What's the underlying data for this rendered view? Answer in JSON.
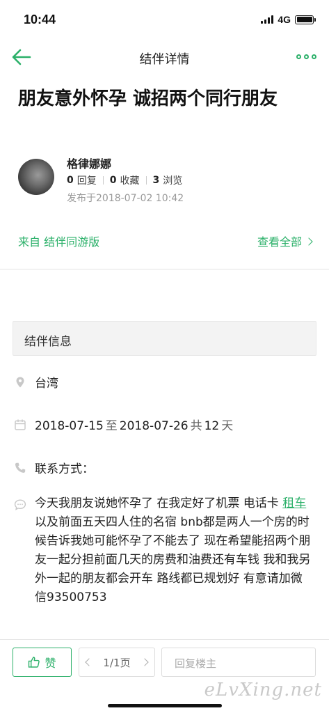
{
  "status": {
    "time": "10:44",
    "network": "4G"
  },
  "nav": {
    "title": "结伴详情"
  },
  "post": {
    "title": "朋友意外怀孕 诚招两个同行朋友",
    "author": "格律娜娜",
    "replies_count": "0",
    "replies_label": "回复",
    "favorites_count": "0",
    "favorites_label": "收藏",
    "views_count": "3",
    "views_label": "浏览",
    "published": "发布于2018-07-02 10:42"
  },
  "source": {
    "label": "来自 结伴同游版",
    "view_all": "查看全部"
  },
  "info": {
    "section_title": "结伴信息",
    "location": "台湾",
    "date_start": "2018-07-15",
    "date_to": "至",
    "date_end": "2018-07-26",
    "date_total_prefix": "共",
    "date_days": "12",
    "date_unit": "天",
    "contact_label": "联系方式：",
    "desc_part1": "今天我朋友说她怀孕了 在我定好了机票 电话卡 ",
    "desc_link": "租车",
    "desc_part2": "以及前面五天四人住的名宿 bnb都是两人一个房的时候告诉我她可能怀孕了不能去了 现在希望能招两个朋友一起分担前面几天的房费和油费还有车钱 我和我另外一起的朋友都会开车 路线都已规划好 有意请加微信93500753"
  },
  "bottom": {
    "like": "赞",
    "page": "1/1页",
    "reply_placeholder": "回复楼主"
  },
  "watermark": "eLvXing.net",
  "colors": {
    "accent": "#2bb069",
    "muted": "#999999",
    "icon": "#c8c8c8"
  }
}
